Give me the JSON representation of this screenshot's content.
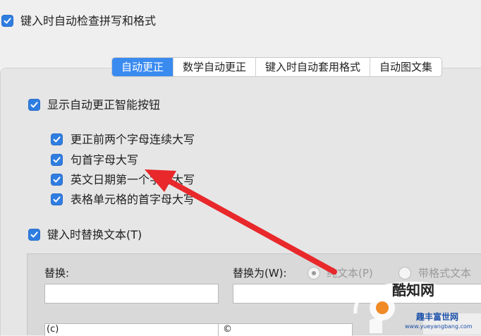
{
  "top": {
    "spell_check_label": "键入时自动检查拼写和格式"
  },
  "tabs": [
    {
      "label": "自动更正"
    },
    {
      "label": "数学自动更正"
    },
    {
      "label": "键入时自动套用格式"
    },
    {
      "label": "自动图文集"
    }
  ],
  "autocorrect": {
    "show_buttons_label": "显示自动更正智能按钮",
    "options": [
      {
        "label": "更正前两个字母连续大写"
      },
      {
        "label": "句首字母大写"
      },
      {
        "label": "英文日期第一个字母大写"
      },
      {
        "label": "表格单元格的首字母大写"
      }
    ],
    "replace_text_label": "键入时替换文本(T)"
  },
  "replace": {
    "replace_label": "替换:",
    "with_label": "替换为(W):",
    "plain_text_label": "纯文本(P)",
    "formatted_text_label": "带格式文本",
    "row_first_cell": "(c)",
    "row_second_cell": "©"
  },
  "watermark": {
    "brand": "酷知网",
    "sub": "趣丰富世网",
    "url": "www.yueyangbang.com"
  },
  "colors": {
    "accent": "#3a8bf0",
    "checkbox": "#2f7de1",
    "arrow": "#e8282b"
  }
}
